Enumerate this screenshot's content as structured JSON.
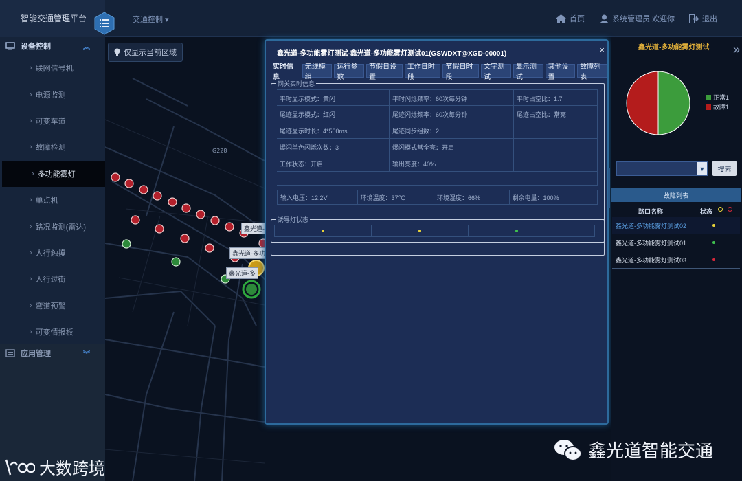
{
  "header": {
    "app_title": "智能交通管理平台",
    "nav_traffic": "交通控制",
    "home": "首页",
    "user": "系统管理员,欢迎你",
    "logout": "退出"
  },
  "sidebar": {
    "group1": "设备控制",
    "items": [
      "联网信号机",
      "电源监测",
      "可变车道",
      "故障检测",
      "多功能雾灯",
      "单点机",
      "路况监测(雷达)",
      "人行触摸",
      "人行过街",
      "弯道预警",
      "可变情报板"
    ],
    "group2": "应用管理"
  },
  "map": {
    "show_area_button": "仅显示当前区域",
    "road_label": "G228",
    "marker_labels": [
      "鑫光道-",
      "鑫光道-多功",
      "鑫光道-多"
    ]
  },
  "modal": {
    "title": "鑫光道-多功能雾灯测试-鑫光道-多功能雾灯测试01(GSWDXT@XGD-00001)",
    "close": "×",
    "tabs": [
      "实时信息",
      "无线模组",
      "运行参数",
      "节假日设置",
      "工作日时段",
      "节假日时段",
      "文字测试",
      "显示测试",
      "其他设置",
      "故障列表"
    ],
    "section1": "网关实时信息",
    "rows": [
      [
        "平时显示模式：黄闪",
        "平时闪烁频率：60次每分钟",
        "平时占空比：1:7"
      ],
      [
        "尾迹显示模式：红闪",
        "尾迹闪烁频率：60次每分钟",
        "尾迹占空比：常亮"
      ],
      [
        "尾迹显示时长：4*500ms",
        "尾迹同步组数：2",
        ""
      ],
      [
        "爆闪单色闪烁次数：3",
        "爆闪模式常全亮：开启",
        ""
      ],
      [
        "工作状态：开启",
        "输出亮度：40%",
        ""
      ]
    ],
    "status": [
      "输入电压：12.2V",
      "环境温度：37℃",
      "环境湿度：66%",
      "剩余电量：100%"
    ],
    "section2": "诱导灯状态"
  },
  "right_panel": {
    "title": "鑫光道-多功能雾灯测试",
    "legend": [
      {
        "label": "正常1",
        "color": "#3c9c3c"
      },
      {
        "label": "故障1",
        "color": "#b41c1c"
      }
    ],
    "pie": {
      "normal": 1,
      "fault": 1
    },
    "search_button": "搜索",
    "fault_list": "故障列表",
    "col_name": "路口名称",
    "col_status": "状态",
    "rows": [
      {
        "name": "鑫光道-多功能雾灯测试02",
        "status_color": "#e6d23a",
        "highlight": true
      },
      {
        "name": "鑫光道-多功能雾灯测试01",
        "status_color": "#3fbf4f",
        "highlight": false
      },
      {
        "name": "鑫光道-多功能雾灯测试03",
        "status_color": "#d8283a",
        "highlight": false
      }
    ]
  },
  "watermarks": {
    "left": "大数跨境",
    "right": "鑫光道智能交通"
  }
}
